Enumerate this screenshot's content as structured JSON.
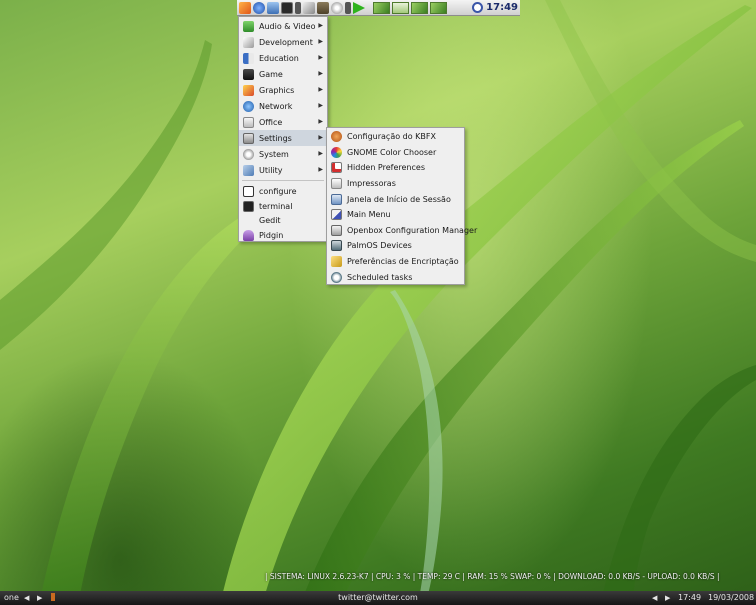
{
  "top_panel": {
    "clock": "17:49",
    "launcher_icons": [
      "start-menu-icon",
      "browser-icon",
      "home-folder-icon",
      "terminal-icon",
      "small-app-icon",
      "pen-icon",
      "gimp-icon",
      "cd-icon",
      "small-app-2-icon",
      "play-icon"
    ],
    "workspace_thumbnails": 4
  },
  "main_menu": {
    "items": [
      {
        "label": "Audio & Video",
        "icon": "audio-video-icon",
        "has_submenu": true
      },
      {
        "label": "Development",
        "icon": "development-icon",
        "has_submenu": true
      },
      {
        "label": "Education",
        "icon": "education-icon",
        "has_submenu": true
      },
      {
        "label": "Game",
        "icon": "game-icon",
        "has_submenu": true
      },
      {
        "label": "Graphics",
        "icon": "graphics-icon",
        "has_submenu": true
      },
      {
        "label": "Network",
        "icon": "network-icon",
        "has_submenu": true
      },
      {
        "label": "Office",
        "icon": "office-icon",
        "has_submenu": true
      },
      {
        "label": "Settings",
        "icon": "settings-icon",
        "has_submenu": true,
        "active": true
      },
      {
        "label": "System",
        "icon": "system-icon",
        "has_submenu": true
      },
      {
        "label": "Utility",
        "icon": "utility-icon",
        "has_submenu": true
      }
    ],
    "extra_items": [
      {
        "label": "configure",
        "icon": "configure-icon"
      },
      {
        "label": "terminal",
        "icon": "terminal-icon"
      },
      {
        "label": "Gedit",
        "icon": ""
      },
      {
        "label": "Pidgin",
        "icon": "pidgin-icon"
      }
    ]
  },
  "settings_submenu": {
    "items": [
      {
        "label": "Configuração do KBFX",
        "icon": "kbfx-icon"
      },
      {
        "label": "GNOME Color Chooser",
        "icon": "color-chooser-icon"
      },
      {
        "label": "Hidden Preferences",
        "icon": "hidden-prefs-icon"
      },
      {
        "label": "Impressoras",
        "icon": "printer-icon"
      },
      {
        "label": "Janela de Início de Sessão",
        "icon": "login-window-icon"
      },
      {
        "label": "Main Menu",
        "icon": "main-menu-icon"
      },
      {
        "label": "Openbox Configuration Manager",
        "icon": "openbox-icon"
      },
      {
        "label": "PalmOS Devices",
        "icon": "palm-device-icon"
      },
      {
        "label": "Preferências de Encriptação",
        "icon": "encryption-icon"
      },
      {
        "label": "Scheduled tasks",
        "icon": "scheduled-tasks-icon"
      }
    ]
  },
  "sysinfo": "| SISTEMA: LINUX 2.6.23-K7 | CPU: 3  % | TEMP: 29  C | RAM: 15 % SWAP: 0  % | DOWNLOAD: 0.0   KB/S - UPLOAD: 0.0   KB/S |",
  "bottom_panel": {
    "desktop_name": "one",
    "task_title": "twitter@twitter.com",
    "time": "17:49",
    "date": "19/03/2008"
  },
  "colors": {
    "wallpaper_green": "#6ea43a",
    "menu_bg": "#efefef",
    "menu_active": "#cfd6de",
    "panel_dark": "#161616"
  }
}
